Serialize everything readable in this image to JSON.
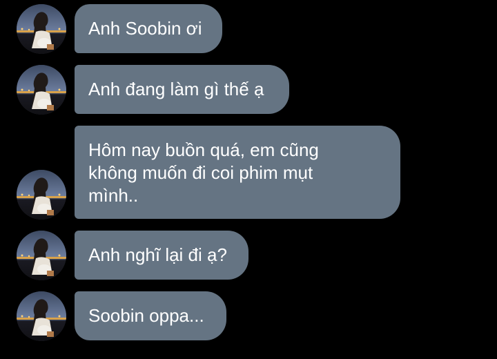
{
  "messages": [
    {
      "text": "Anh Soobin ơi"
    },
    {
      "text": "Anh đang làm gì thế ạ"
    },
    {
      "text": "Hôm nay buồn quá, em cũng\nkhông muốn đi coi phim mụt\nmình.."
    },
    {
      "text": "Anh nghĩ lại đi ạ?"
    },
    {
      "text": "Soobin oppa..."
    }
  ],
  "colors": {
    "background": "#000000",
    "bubble": "#657483",
    "text": "#ffffff"
  },
  "icons": {
    "avatar": "sender-avatar-photo"
  }
}
